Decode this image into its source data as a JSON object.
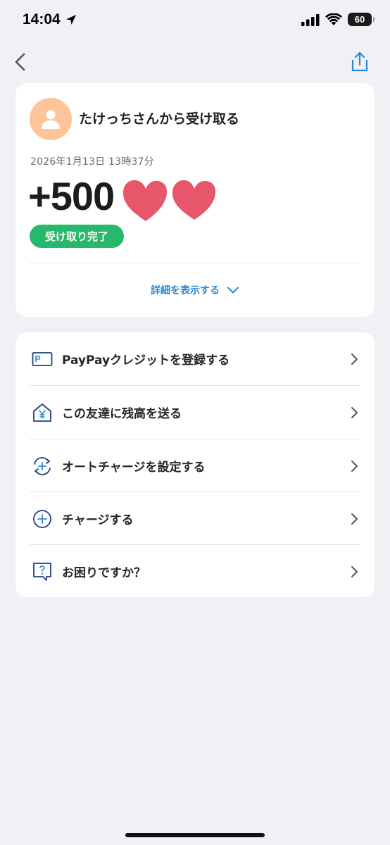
{
  "status_bar": {
    "time": "14:04",
    "battery": "60"
  },
  "transaction": {
    "title": "たけっちさんから受け取る",
    "date": "2026年1月13日 13時37分",
    "amount": "+500",
    "status": "受け取り完了",
    "details_link": "詳細を表示する"
  },
  "menu": {
    "items": [
      {
        "label": "PayPayクレジットを登録する",
        "icon": "card-icon"
      },
      {
        "label": "この友達に残高を送る",
        "icon": "yen-house-icon"
      },
      {
        "label": "オートチャージを設定する",
        "icon": "auto-charge-icon"
      },
      {
        "label": "チャージする",
        "icon": "plus-circle-icon"
      },
      {
        "label": "お困りですか？",
        "icon": "help-bubble-icon"
      }
    ]
  },
  "colors": {
    "accent_blue": "#2b87d6",
    "icon_navy": "#1f3f82",
    "success_green": "#26b96b",
    "avatar_bg": "#ffc49a",
    "heart": "#e8566c",
    "background": "#f0f1f5"
  }
}
